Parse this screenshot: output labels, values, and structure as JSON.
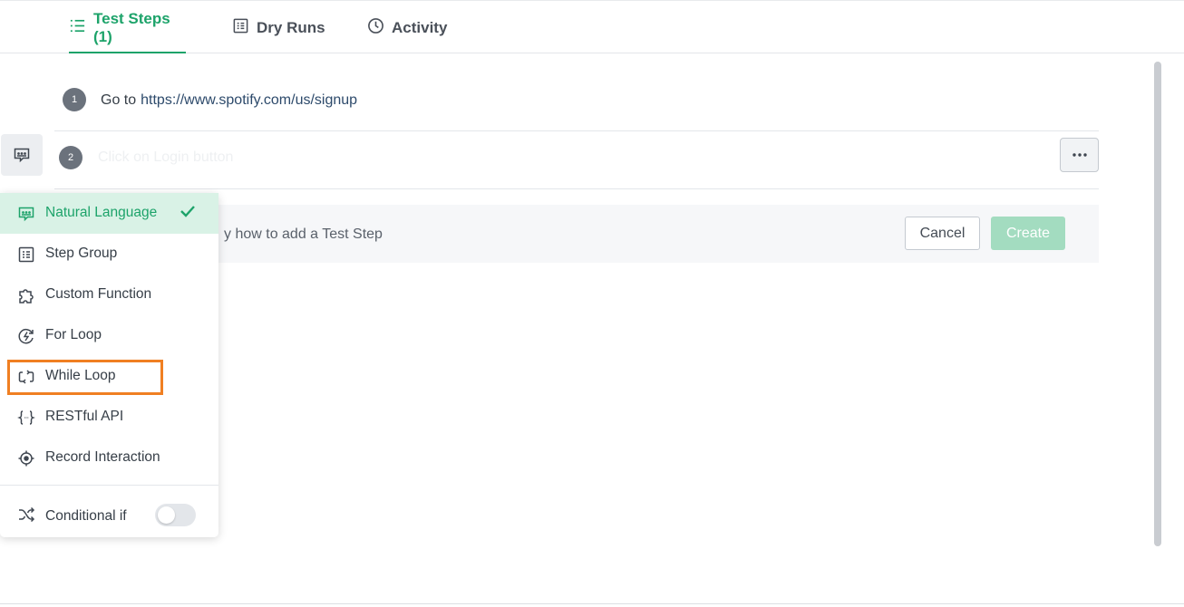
{
  "tabs": [
    {
      "label": "Test Steps (1)",
      "icon": "list-icon",
      "active": true
    },
    {
      "label": "Dry Runs",
      "icon": "document-icon",
      "active": false
    },
    {
      "label": "Activity",
      "icon": "clock-icon",
      "active": false
    }
  ],
  "steps": [
    {
      "number": "1",
      "action": "Go to",
      "url": "https://www.spotify.com/us/signup"
    },
    {
      "number": "2",
      "placeholder": "Click on Login button"
    }
  ],
  "help": {
    "text": "y how to add a Test Step",
    "cancel_label": "Cancel",
    "create_label": "Create"
  },
  "menu": {
    "items": [
      {
        "label": "Natural Language",
        "icon": "natural-language-icon",
        "selected": true
      },
      {
        "label": "Step Group",
        "icon": "step-group-icon"
      },
      {
        "label": "Custom Function",
        "icon": "puzzle-icon"
      },
      {
        "label": "For Loop",
        "icon": "for-loop-icon"
      },
      {
        "label": "While Loop",
        "icon": "while-loop-icon"
      },
      {
        "label": "RESTful API",
        "icon": "braces-icon"
      },
      {
        "label": "Record Interaction",
        "icon": "record-icon"
      }
    ],
    "conditional_label": "Conditional if",
    "conditional_enabled": false
  },
  "colors": {
    "accent": "#1da36a",
    "highlight": "#f07f22",
    "create_disabled": "#a3dcc0"
  }
}
